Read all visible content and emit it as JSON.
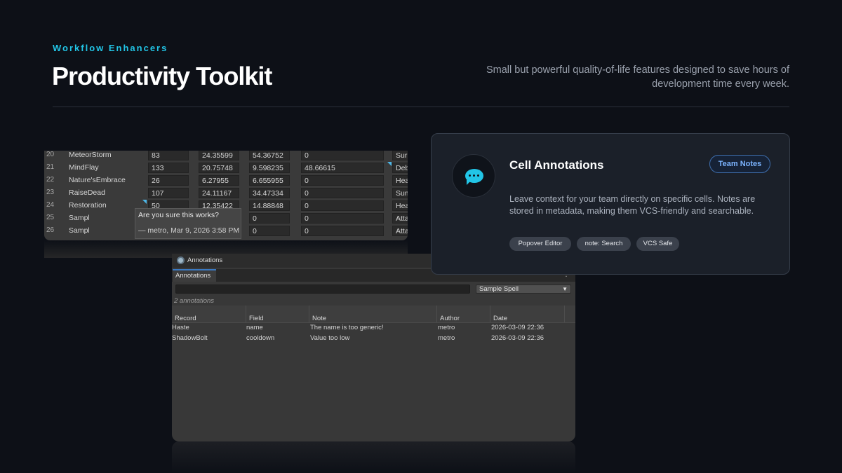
{
  "header": {
    "eyebrow": "Workflow Enhancers",
    "title": "Productivity Toolkit",
    "subtitle": "Small but powerful quality-of-life features designed to save hours of development time every week."
  },
  "sheet": {
    "rows": [
      {
        "num": "20",
        "name": "MeteorStorm",
        "v1": "83",
        "v2": "24.35599",
        "v3": "54.36752",
        "v4": "0",
        "v5": "Sur"
      },
      {
        "num": "21",
        "name": "MindFlay",
        "v1": "133",
        "v2": "20.75748",
        "v3": "9.598235",
        "v4": "48.66615",
        "v5": "Deb"
      },
      {
        "num": "22",
        "name": "Nature'sEmbrace",
        "v1": "26",
        "v2": "6.27955",
        "v3": "6.655955",
        "v4": "0",
        "v5": "Hea"
      },
      {
        "num": "23",
        "name": "RaiseDead",
        "v1": "107",
        "v2": "24.11167",
        "v3": "34.47334",
        "v4": "0",
        "v5": "Sum"
      },
      {
        "num": "24",
        "name": "Restoration",
        "v1": "50",
        "v2": "12.35422",
        "v3": "14.88848",
        "v4": "0",
        "v5": "Hea"
      },
      {
        "num": "25",
        "name": "Sampl",
        "v1": "",
        "v2": "0",
        "v3": "0",
        "v4": "0",
        "v5": "Atta"
      },
      {
        "num": "26",
        "name": "Sampl",
        "v1": "",
        "v2": "0",
        "v3": "0",
        "v4": "0",
        "v5": "Atta"
      }
    ],
    "tooltip": {
      "question": "Are you sure this works?",
      "byline": "— metro, Mar 9, 2026 3:58 PM"
    },
    "accent": "#4db7e8"
  },
  "annotations_window": {
    "title": "Annotations",
    "tab": "Annotations",
    "select_value": "Sample Spell",
    "count": "2 annotations",
    "columns": [
      "Record",
      "Field",
      "Note",
      "Author",
      "Date"
    ],
    "rows": [
      {
        "record": "Haste",
        "field": "name",
        "note": "The name is too generic!",
        "author": "metro",
        "date": "2026-03-09 22:36"
      },
      {
        "record": "ShadowBolt",
        "field": "cooldown",
        "note": "Value too low",
        "author": "metro",
        "date": "2026-03-09 22:36"
      }
    ]
  },
  "card": {
    "title": "Cell Annotations",
    "badge": "Team Notes",
    "description": "Leave context for your team directly on specific cells. Notes are stored in metadata, making them VCS-friendly and searchable.",
    "chips": [
      "Popover Editor",
      "note: Search",
      "VCS Safe"
    ],
    "icon": "chat-bubble-icon",
    "accent": "#22c5e6"
  }
}
